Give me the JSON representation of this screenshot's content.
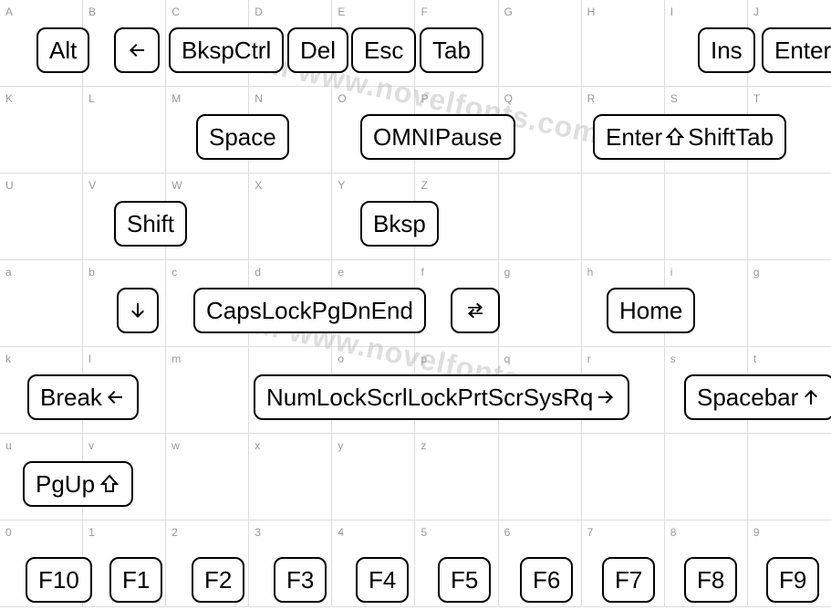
{
  "watermark_text": "from www.novelfonts.com",
  "rows": [
    {
      "labels": [
        "A",
        "B",
        "C",
        "D",
        "E",
        "F",
        "G",
        "H",
        "I",
        "J"
      ]
    },
    {
      "labels": [
        "K",
        "L",
        "M",
        "N",
        "O",
        "P",
        "Q",
        "R",
        "S",
        "T"
      ]
    },
    {
      "labels": [
        "U",
        "V",
        "W",
        "X",
        "Y",
        "Z",
        "",
        "",
        "",
        ""
      ]
    },
    {
      "labels": [
        "a",
        "b",
        "c",
        "d",
        "e",
        "f",
        "g",
        "h",
        "i",
        "g"
      ]
    },
    {
      "labels": [
        "k",
        "l",
        "m",
        "",
        "o",
        "p",
        "q",
        "r",
        "s",
        "t"
      ]
    },
    {
      "labels": [
        "u",
        "v",
        "w",
        "x",
        "y",
        "z",
        "",
        "",
        "",
        ""
      ]
    },
    {
      "labels": [
        "0",
        "1",
        "2",
        "3",
        "4",
        "5",
        "6",
        "7",
        "8",
        "9"
      ]
    }
  ],
  "keys": {
    "r0": {
      "alt": "Alt",
      "bksp_arrow": "←",
      "bksp_ctrl": "BkspCtrl",
      "del": "Del",
      "esc": "Esc",
      "tab": "Tab",
      "ins": "Ins",
      "enter": "Enter"
    },
    "r1": {
      "space": "Space",
      "omni_pause": "OMNIPause",
      "enter_shift_tab": "Enter ⇧ ShiftTab"
    },
    "r2": {
      "shift": "Shift",
      "bksp": "Bksp"
    },
    "r3": {
      "down": "↓",
      "caps_pgdn_end": "CapsLockPgDnEnd",
      "tab_icon": "⇆",
      "home": "Home"
    },
    "r4": {
      "break_left": "Break←",
      "num_scrl_prtsc": "NumLockScrlLockPrtScrSysRq→",
      "spacebar_up": "Spacebar↑"
    },
    "r5": {
      "pgup_shift": "PgUp⇧"
    },
    "r6": {
      "f10": "F10",
      "f1": "F1",
      "f2": "F2",
      "f3": "F3",
      "f4": "F4",
      "f5": "F5",
      "f6": "F6",
      "f7": "F7",
      "f8": "F8",
      "f9": "F9"
    }
  }
}
